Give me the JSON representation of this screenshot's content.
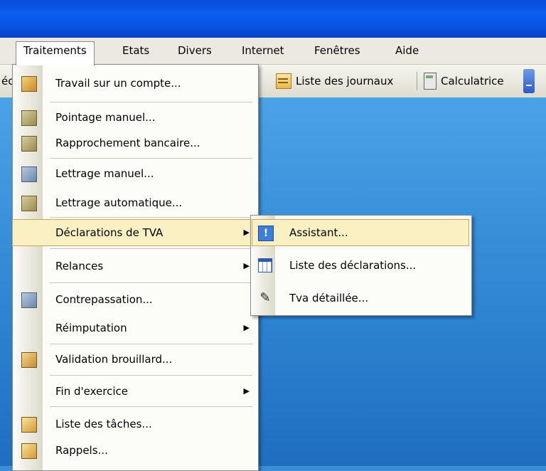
{
  "menubar": {
    "items": [
      "Traitements",
      "Etats",
      "Divers",
      "Internet",
      "Fenêtres",
      "Aide"
    ]
  },
  "toolbar": {
    "left_fragment": "éc",
    "journaux_label": "Liste des journaux",
    "calc_label": "Calculatrice"
  },
  "menu": {
    "items": [
      {
        "label": "Travail sur un compte...",
        "icon": "account-work-icon"
      },
      {
        "label": "Pointage manuel...",
        "icon": "manual-check-icon"
      },
      {
        "label": "Rapprochement bancaire...",
        "icon": "bank-reconcile-icon"
      },
      {
        "label": "Lettrage manuel...",
        "icon": "manual-lettering-icon"
      },
      {
        "label": "Lettrage automatique...",
        "icon": "auto-lettering-icon"
      },
      {
        "label": "Déclarations de TVA",
        "submenu": true
      },
      {
        "label": "Relances",
        "submenu": true
      },
      {
        "label": "Contrepassation...",
        "icon": "reversal-icon"
      },
      {
        "label": "Réimputation",
        "submenu": true
      },
      {
        "label": "Validation brouillard...",
        "icon": "draft-validation-icon"
      },
      {
        "label": "Fin d'exercice",
        "submenu": true
      },
      {
        "label": "Liste des tâches...",
        "icon": "task-list-icon"
      },
      {
        "label": "Rappels...",
        "icon": "reminders-icon"
      }
    ]
  },
  "submenu": {
    "items": [
      {
        "label": "Assistant...",
        "icon": "exclamation-icon"
      },
      {
        "label": "Liste des déclarations...",
        "icon": "list-grid-icon"
      },
      {
        "label": "Tva détaillée...",
        "icon": "tva-detail-icon"
      }
    ]
  },
  "colors": {
    "highlight": "#fbf0c2",
    "titlebar": "#0a50dc",
    "desktop": "#3a8fd6"
  }
}
